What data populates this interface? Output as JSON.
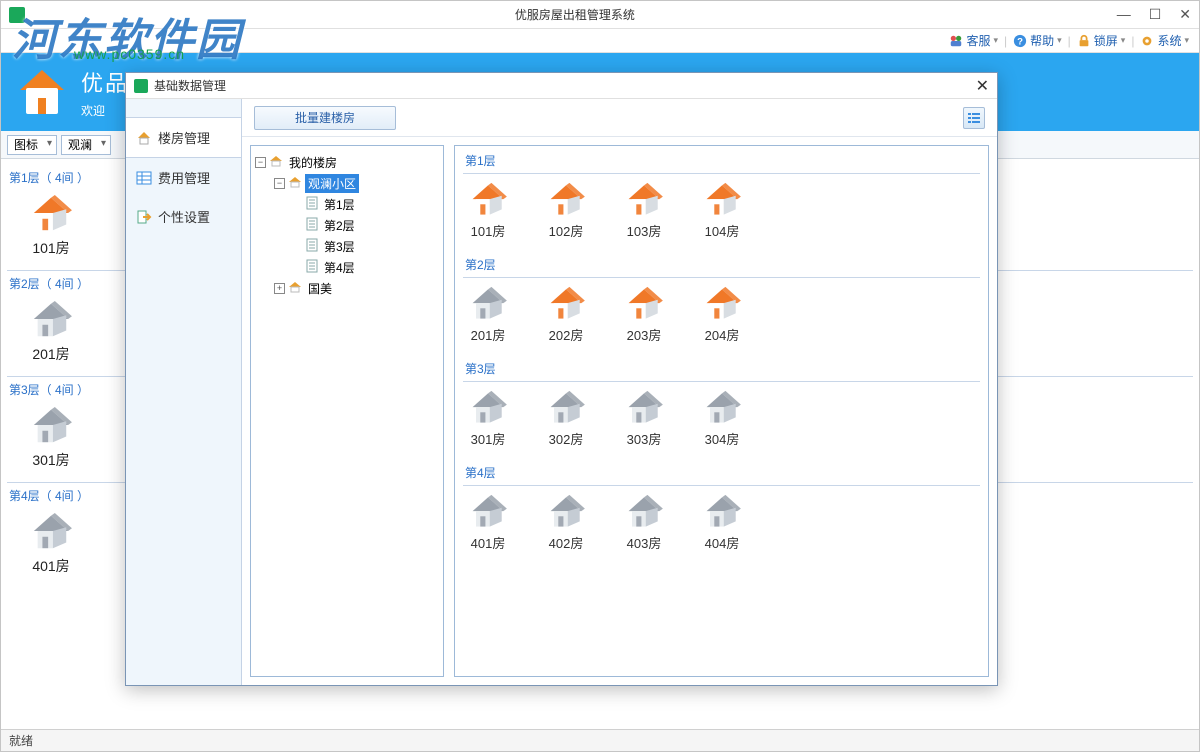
{
  "window": {
    "title": "优服房屋出租管理系统",
    "status": "就绪"
  },
  "watermark": {
    "text": "河东软件园",
    "url": "www.pc0359.cn"
  },
  "toolbar": {
    "service": "客服",
    "help": "帮助",
    "lock": "锁屏",
    "system": "系统"
  },
  "header": {
    "app_title": "优品房屋出租管理系统",
    "welcome": "欢迎"
  },
  "filter": {
    "view_mode": "图标",
    "community": "观澜"
  },
  "main_floors": [
    {
      "header": "第1层（ 4间 ）",
      "rooms": [
        "101房"
      ]
    },
    {
      "header": "第2层（ 4间 ）",
      "rooms": [
        "201房"
      ]
    },
    {
      "header": "第3层（ 4间 ）",
      "rooms": [
        "301房"
      ]
    },
    {
      "header": "第4层（ 4间 ）",
      "rooms": [
        "401房"
      ]
    }
  ],
  "room_states": {
    "main": [
      "orange",
      "grey",
      "grey",
      "grey"
    ]
  },
  "dialog": {
    "title": "基础数据管理",
    "sidebar": [
      {
        "label": "楼房管理",
        "icon": "house"
      },
      {
        "label": "费用管理",
        "icon": "table"
      },
      {
        "label": "个性设置",
        "icon": "export"
      }
    ],
    "batch_button": "批量建楼房",
    "tree": {
      "root": "我的楼房",
      "communities": [
        {
          "name": "观澜小区",
          "selected": true,
          "floors": [
            "第1层",
            "第2层",
            "第3层",
            "第4层"
          ],
          "expanded": true
        },
        {
          "name": "国美",
          "expanded": false
        }
      ]
    },
    "floors": [
      {
        "header": "第1层",
        "rooms": [
          {
            "label": "101房",
            "state": "orange"
          },
          {
            "label": "102房",
            "state": "orange"
          },
          {
            "label": "103房",
            "state": "orange"
          },
          {
            "label": "104房",
            "state": "orange"
          }
        ]
      },
      {
        "header": "第2层",
        "rooms": [
          {
            "label": "201房",
            "state": "grey"
          },
          {
            "label": "202房",
            "state": "orange"
          },
          {
            "label": "203房",
            "state": "orange"
          },
          {
            "label": "204房",
            "state": "orange"
          }
        ]
      },
      {
        "header": "第3层",
        "rooms": [
          {
            "label": "301房",
            "state": "grey"
          },
          {
            "label": "302房",
            "state": "grey"
          },
          {
            "label": "303房",
            "state": "grey"
          },
          {
            "label": "304房",
            "state": "grey"
          }
        ]
      },
      {
        "header": "第4层",
        "rooms": [
          {
            "label": "401房",
            "state": "grey"
          },
          {
            "label": "402房",
            "state": "grey"
          },
          {
            "label": "403房",
            "state": "grey"
          },
          {
            "label": "404房",
            "state": "grey"
          }
        ]
      }
    ]
  }
}
